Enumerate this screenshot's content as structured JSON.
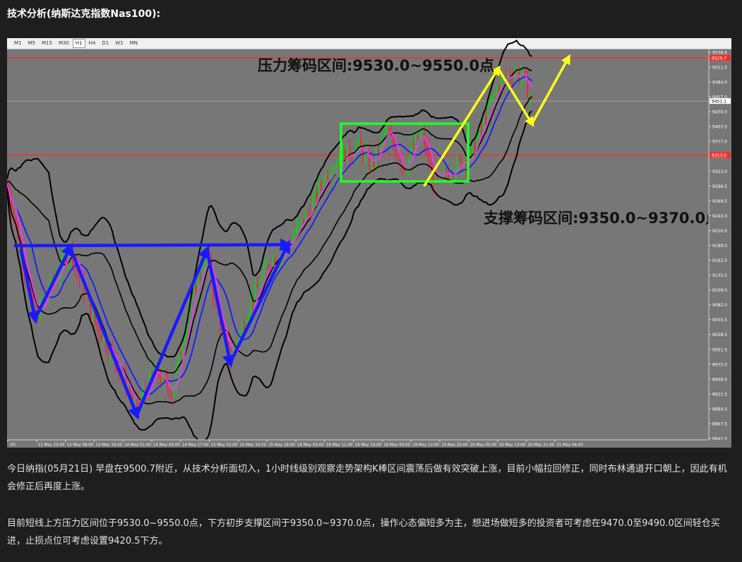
{
  "page": {
    "title": "技术分析(纳斯达克指数Nas100):",
    "paragraphs": [
      "今日纳指(05月21日) 早盘在9500.7附近，从技术分析面切入，1小时线级别观察走势架构K棒区间震荡后做有效突破上涨，目前小幅拉回修正，同时布林通道开口朝上，因此有机会修正后再度上涨。",
      "目前短线上方压力区间位于9530.0~9550.0点，下方初步支撑区间于9350.0~9370.0点，操作心态偏短多为主，想进场做短多的投资者可考虑在9470.0至9490.0区间轻仓买进，止损点位可考虑设置9420.5下方。"
    ]
  },
  "toolbar": {
    "timeframes": [
      "M1",
      "M5",
      "M15",
      "M30",
      "H1",
      "H4",
      "D1",
      "W1",
      "MN"
    ],
    "active": "H1"
  },
  "chart_data": {
    "type": "candlestick",
    "symbol": "Nas100",
    "timeframe": "H1",
    "ylim": [
      8835,
      9545
    ],
    "y_ticks": [
      9538.6,
      9511.0,
      9484.0,
      9457.0,
      9430.0,
      9403.5,
      9377.0,
      9350.0,
      9323.0,
      9296.5,
      9269.5,
      9243.0,
      9216.0,
      9189.0,
      9162.5,
      9135.5,
      9109.0,
      9082.0,
      9055.5,
      9028.5,
      9001.5,
      8975.0,
      8948.0,
      8921.5,
      8894.5,
      8867.5,
      8841.0
    ],
    "x_ticks": [
      ":00",
      "12 May 23:00",
      "13 May 08:00",
      "13 May 16:00",
      "14 May 01:00",
      "14 May 09:00",
      "14 May 17:00",
      "15 May 02:00",
      "15 May 10:00",
      "15 May 18:00",
      "18 May 03:00",
      "18 May 11:00",
      "18 May 19:00",
      "19 May 04:00",
      "19 May 12:00",
      "19 May 20:00",
      "20 May 05:00",
      "20 May 13:00",
      "20 May 21:00",
      "21 May 06:00"
    ],
    "price_tags": [
      {
        "value": 9529.7,
        "label": "9529.7",
        "color": "#ff2a2a"
      },
      {
        "value": 9451.1,
        "label": "9451.1",
        "color": "#ffffff"
      },
      {
        "value": 9353.0,
        "label": "9353.0",
        "color": "#ff2a2a"
      }
    ],
    "resistance_label": "压力筹码区间:9530.0~9550.0点",
    "support_label": "支撑筹码区间:9350.0~9370.0点",
    "resistance": [
      9530,
      9550
    ],
    "support": [
      9350,
      9370
    ],
    "horizontal_lines": [
      {
        "value": 9529.7,
        "color": "#ff2a2a"
      },
      {
        "value": 9451.1,
        "color": "#9b9b9b"
      },
      {
        "value": 9353.0,
        "color": "#ff2a2a"
      }
    ],
    "consolidation_box": {
      "x_start": 0.476,
      "x_end": 0.657,
      "y_low": 9305,
      "y_high": 9410,
      "color": "#22ff22"
    },
    "blue_neckline": {
      "x": [
        0.01,
        0.4
      ],
      "y": [
        9188,
        9190
      ]
    },
    "blue_path": {
      "x": [
        0.02,
        0.04,
        0.09,
        0.185,
        0.285,
        0.318,
        0.4
      ],
      "y": [
        9180,
        9055,
        9185,
        8880,
        9180,
        8975,
        9190
      ]
    },
    "yellow_path": {
      "x": [
        0.595,
        0.7,
        0.748,
        0.8
      ],
      "y": [
        9298,
        9510,
        9410,
        9530
      ]
    },
    "colors": {
      "background": "#777777",
      "bull": "#00e000",
      "bear": "#ff1a3c",
      "ma_fast": "#ff30ff",
      "ma_slow": "#1a1aff",
      "bands": "#000000",
      "annotation_blue": "#1a1aff",
      "annotation_yellow": "#ffff1a"
    }
  }
}
